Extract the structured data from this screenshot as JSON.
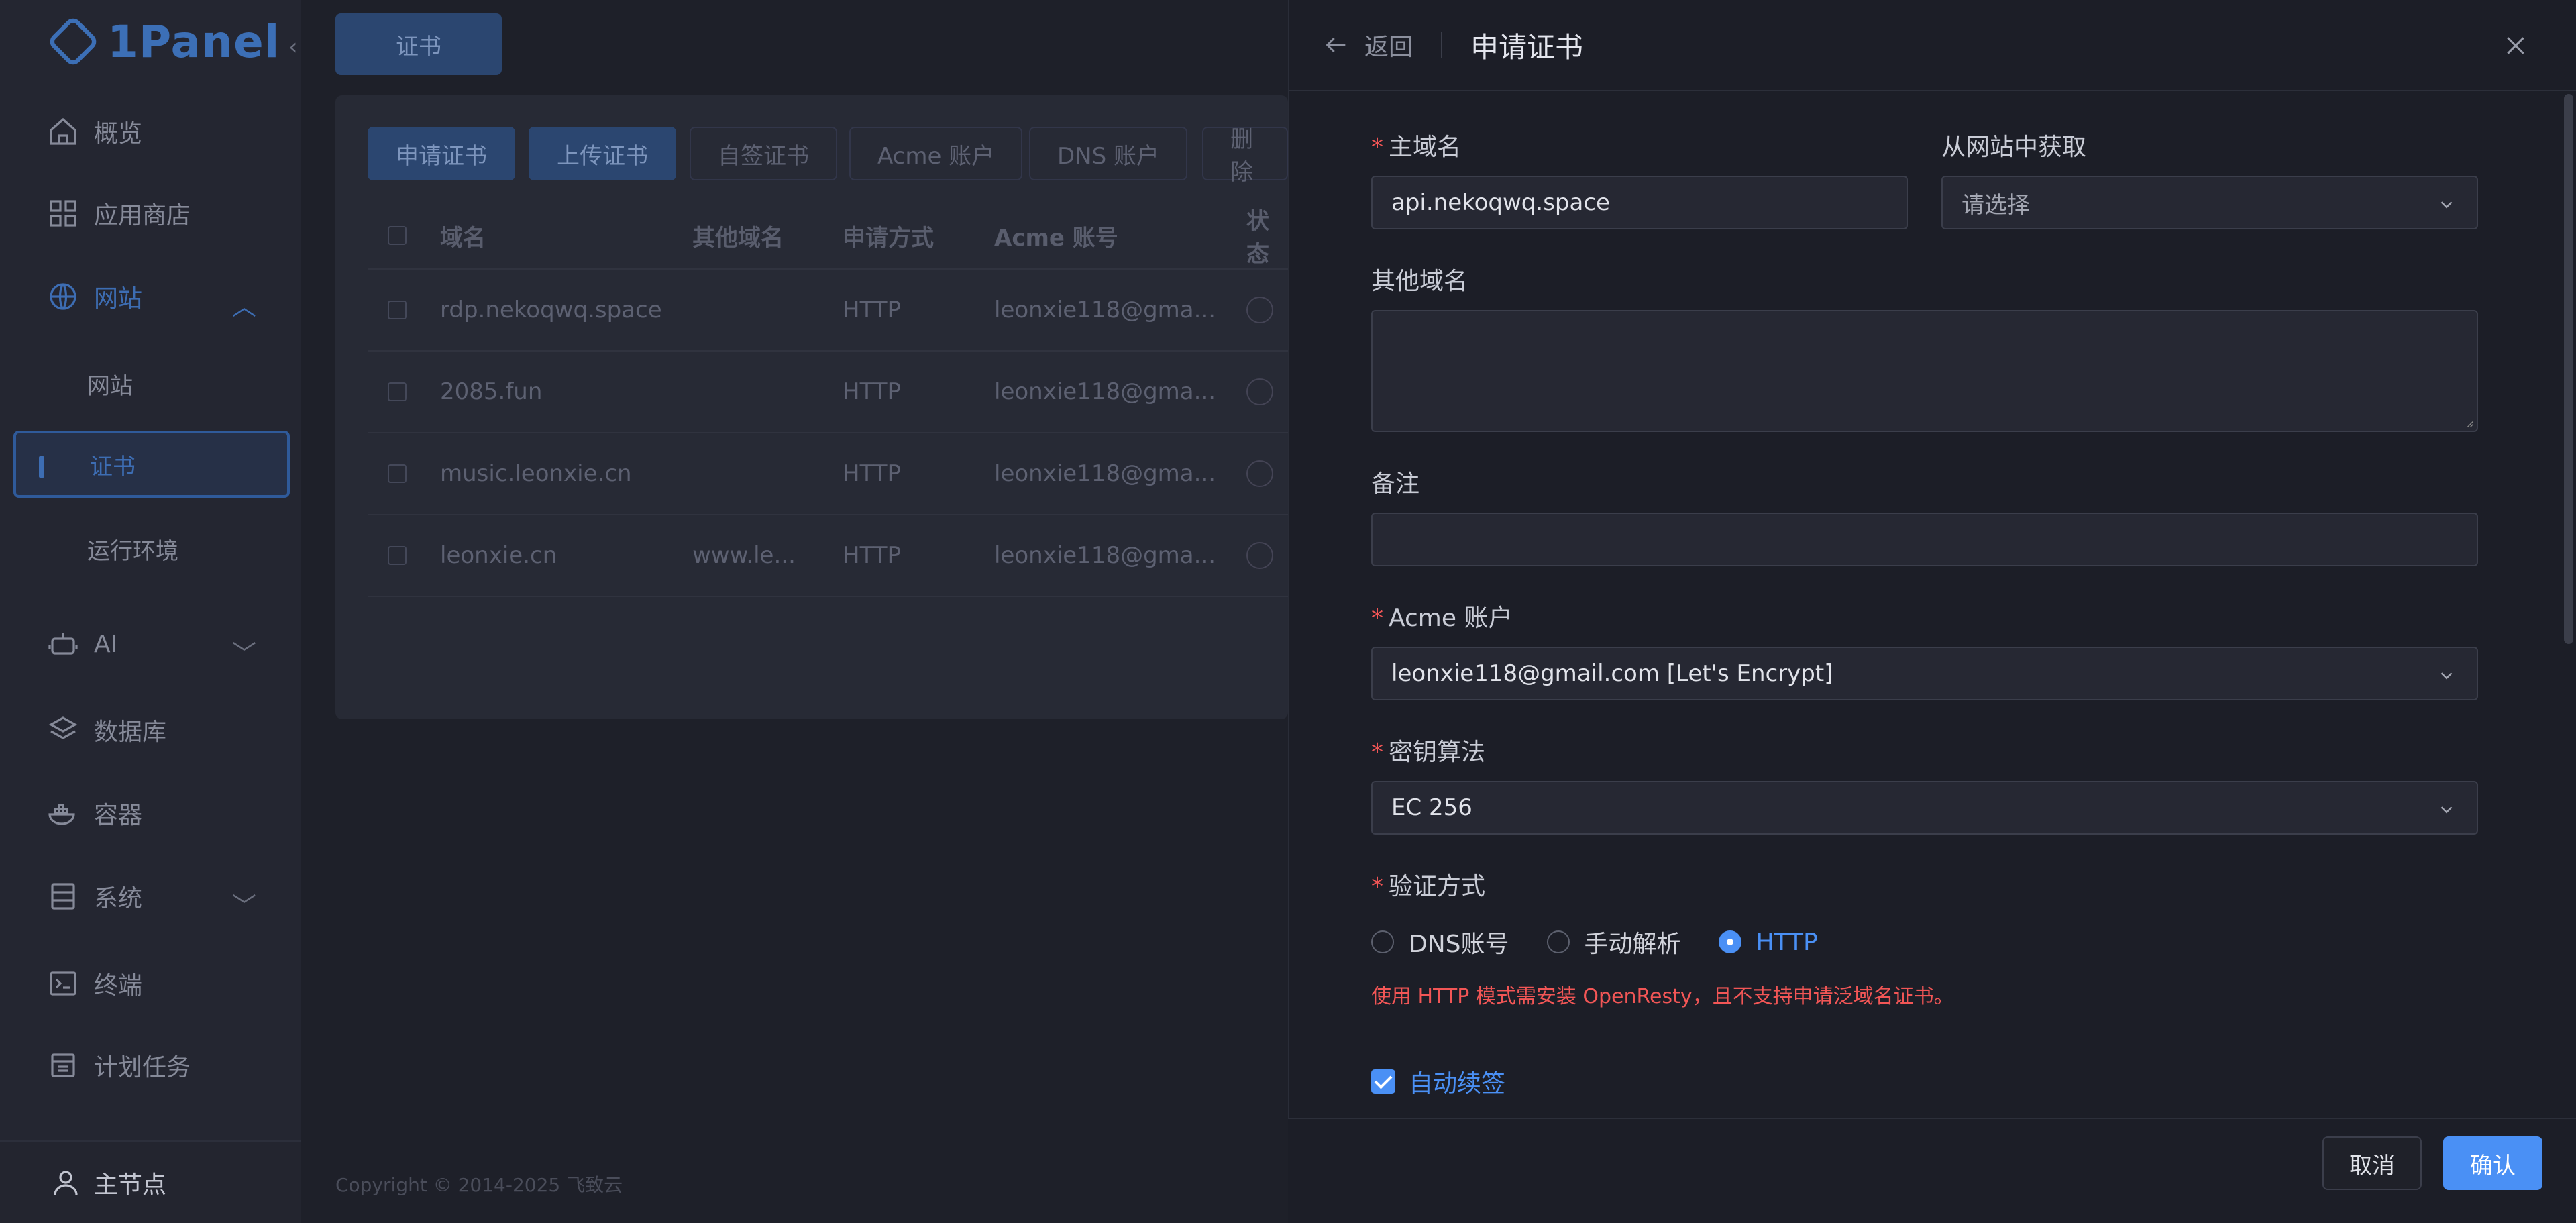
{
  "app": {
    "logo_text": "1Panel"
  },
  "sidebar": {
    "items": [
      {
        "label": "概览",
        "icon": "home-icon"
      },
      {
        "label": "应用商店",
        "icon": "grid-icon"
      },
      {
        "label": "网站",
        "icon": "globe-icon",
        "expanded": true
      },
      {
        "label": "AI",
        "icon": "robot-icon"
      },
      {
        "label": "数据库",
        "icon": "layers-icon"
      },
      {
        "label": "容器",
        "icon": "docker-icon"
      },
      {
        "label": "系统",
        "icon": "server-icon"
      },
      {
        "label": "终端",
        "icon": "terminal-icon"
      },
      {
        "label": "计划任务",
        "icon": "calendar-icon"
      }
    ],
    "subitems": [
      {
        "label": "网站"
      },
      {
        "label": "证书",
        "active": true
      },
      {
        "label": "运行环境"
      }
    ],
    "footer_label": "主节点"
  },
  "main": {
    "tab_label": "证书",
    "toolbar": [
      "申请证书",
      "上传证书",
      "自签证书",
      "Acme 账户",
      "DNS 账户",
      "删除"
    ],
    "table": {
      "headers": [
        "域名",
        "其他域名",
        "申请方式",
        "Acme 账号",
        "状态"
      ],
      "rows": [
        {
          "domain": "rdp.nekoqwq.space",
          "other": "",
          "method": "HTTP",
          "acme": "leonxie118@gma..."
        },
        {
          "domain": "2085.fun",
          "other": "",
          "method": "HTTP",
          "acme": "leonxie118@gma..."
        },
        {
          "domain": "music.leonxie.cn",
          "other": "",
          "method": "HTTP",
          "acme": "leonxie118@gma..."
        },
        {
          "domain": "leonxie.cn",
          "other": "www.le...",
          "method": "HTTP",
          "acme": "leonxie118@gma..."
        }
      ]
    },
    "copyright": "Copyright © 2014-2025 飞致云"
  },
  "drawer": {
    "back_label": "返回",
    "title": "申请证书",
    "fields": {
      "primary_domain": {
        "label": "主域名",
        "value": "api.nekoqwq.space"
      },
      "from_website": {
        "label": "从网站中获取",
        "placeholder": "请选择"
      },
      "other_domains": {
        "label": "其他域名",
        "value": ""
      },
      "remark": {
        "label": "备注",
        "value": ""
      },
      "acme_account": {
        "label": "Acme 账户",
        "value": "leonxie118@gmail.com [Let's Encrypt]"
      },
      "key_algorithm": {
        "label": "密钥算法",
        "value": "EC 256"
      },
      "verify_method": {
        "label": "验证方式",
        "options": [
          "DNS账号",
          "手动解析",
          "HTTP"
        ],
        "selected": "HTTP"
      }
    },
    "warning": "使用 HTTP 模式需安装 OpenResty，且不支持申请泛域名证书。",
    "auto_renew_label": "自动续签",
    "cancel_label": "取消",
    "confirm_label": "确认"
  },
  "colors": {
    "accent": "#4a90f5",
    "danger": "#f25656",
    "drawer_bg": "#1c1e27"
  }
}
